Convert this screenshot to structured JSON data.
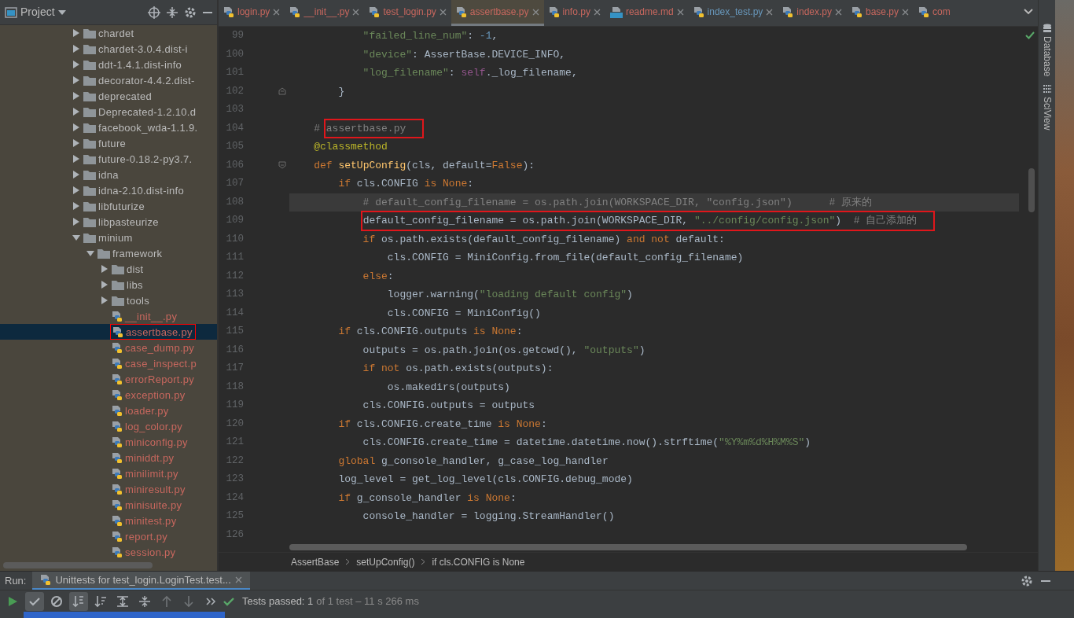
{
  "project_panel": {
    "title": "Project",
    "tree": [
      {
        "kind": "folder",
        "label": "chardet",
        "expanded": false,
        "selected": false,
        "annotated": false
      },
      {
        "kind": "folder",
        "label": "chardet-3.0.4.dist-i",
        "expanded": false,
        "selected": false,
        "annotated": false
      },
      {
        "kind": "folder",
        "label": "ddt-1.4.1.dist-info",
        "expanded": false,
        "selected": false,
        "annotated": false
      },
      {
        "kind": "folder",
        "label": "decorator-4.4.2.dist-",
        "expanded": false,
        "selected": false,
        "annotated": false
      },
      {
        "kind": "folder",
        "label": "deprecated",
        "expanded": false,
        "selected": false,
        "annotated": false
      },
      {
        "kind": "folder",
        "label": "Deprecated-1.2.10.d",
        "expanded": false,
        "selected": false,
        "annotated": false
      },
      {
        "kind": "folder",
        "label": "facebook_wda-1.1.9.",
        "expanded": false,
        "selected": false,
        "annotated": false
      },
      {
        "kind": "folder",
        "label": "future",
        "expanded": false,
        "selected": false,
        "annotated": false
      },
      {
        "kind": "folder",
        "label": "future-0.18.2-py3.7.",
        "expanded": false,
        "selected": false,
        "annotated": false
      },
      {
        "kind": "folder",
        "label": "idna",
        "expanded": false,
        "selected": false,
        "annotated": false
      },
      {
        "kind": "folder",
        "label": "idna-2.10.dist-info",
        "expanded": false,
        "selected": false,
        "annotated": false
      },
      {
        "kind": "folder",
        "label": "libfuturize",
        "expanded": false,
        "selected": false,
        "annotated": false
      },
      {
        "kind": "folder",
        "label": "libpasteurize",
        "expanded": false,
        "selected": false,
        "annotated": false
      },
      {
        "kind": "folder",
        "label": "minium",
        "expanded": true,
        "selected": false,
        "annotated": false,
        "children": [
          {
            "kind": "folder",
            "label": "framework",
            "expanded": true,
            "selected": false,
            "annotated": false,
            "children": [
              {
                "kind": "folder",
                "label": "dist",
                "expanded": false,
                "selected": false,
                "annotated": false
              },
              {
                "kind": "folder",
                "label": "libs",
                "expanded": false,
                "selected": false,
                "annotated": false
              },
              {
                "kind": "folder",
                "label": "tools",
                "expanded": false,
                "selected": false,
                "annotated": false
              },
              {
                "kind": "file",
                "label": "__init__.py",
                "selected": false,
                "annotated": false
              },
              {
                "kind": "file",
                "label": "assertbase.py",
                "selected": true,
                "annotated": true
              },
              {
                "kind": "file",
                "label": "case_dump.py",
                "selected": false,
                "annotated": false
              },
              {
                "kind": "file",
                "label": "case_inspect.p",
                "selected": false,
                "annotated": false
              },
              {
                "kind": "file",
                "label": "errorReport.py",
                "selected": false,
                "annotated": false
              },
              {
                "kind": "file",
                "label": "exception.py",
                "selected": false,
                "annotated": false
              },
              {
                "kind": "file",
                "label": "loader.py",
                "selected": false,
                "annotated": false
              },
              {
                "kind": "file",
                "label": "log_color.py",
                "selected": false,
                "annotated": false
              },
              {
                "kind": "file",
                "label": "miniconfig.py",
                "selected": false,
                "annotated": false
              },
              {
                "kind": "file",
                "label": "miniddt.py",
                "selected": false,
                "annotated": false
              },
              {
                "kind": "file",
                "label": "minilimit.py",
                "selected": false,
                "annotated": false
              },
              {
                "kind": "file",
                "label": "miniresult.py",
                "selected": false,
                "annotated": false
              },
              {
                "kind": "file",
                "label": "minisuite.py",
                "selected": false,
                "annotated": false
              },
              {
                "kind": "file",
                "label": "minitest.py",
                "selected": false,
                "annotated": false
              },
              {
                "kind": "file",
                "label": "report.py",
                "selected": false,
                "annotated": false
              },
              {
                "kind": "file",
                "label": "session.py",
                "selected": false,
                "annotated": false
              }
            ]
          }
        ]
      }
    ]
  },
  "tabs": [
    {
      "kind": "py",
      "label": "login.py",
      "selected": false,
      "color": "#c7675e"
    },
    {
      "kind": "py",
      "label": "__init__.py",
      "selected": false,
      "color": "#c7675e"
    },
    {
      "kind": "py",
      "label": "test_login.py",
      "selected": false,
      "color": "#c7675e"
    },
    {
      "kind": "py",
      "label": "assertbase.py",
      "selected": true,
      "color": "#c7675e"
    },
    {
      "kind": "py",
      "label": "info.py",
      "selected": false,
      "color": "#c7675e"
    },
    {
      "kind": "md",
      "label": "readme.md",
      "selected": false,
      "color": "#c7675e"
    },
    {
      "kind": "py",
      "label": "index_test.py",
      "selected": false,
      "color": "#6897bb"
    },
    {
      "kind": "py",
      "label": "index.py",
      "selected": false,
      "color": "#c7675e"
    },
    {
      "kind": "py",
      "label": "base.py",
      "selected": false,
      "color": "#c7675e"
    },
    {
      "kind": "py",
      "label": "com",
      "selected": false,
      "color": "#c7675e"
    }
  ],
  "editor": {
    "lines": [
      {
        "number": "99",
        "current": false,
        "code": [
          {
            "kind": "s",
            "text": "            \"failed_line_num\""
          },
          {
            "kind": "p",
            "text": ": "
          },
          {
            "kind": "n",
            "text": "-1"
          },
          {
            "kind": "p",
            "text": ","
          }
        ]
      },
      {
        "number": "100",
        "current": false,
        "code": [
          {
            "kind": "s",
            "text": "            \"device\""
          },
          {
            "kind": "p",
            "text": ": AssertBase.DEVICE_INFO,"
          }
        ]
      },
      {
        "number": "101",
        "current": false,
        "code": [
          {
            "kind": "s",
            "text": "            \"log_filename\""
          },
          {
            "kind": "p",
            "text": ": "
          },
          {
            "kind": "self",
            "text": "self"
          },
          {
            "kind": "p",
            "text": "._log_filename,"
          }
        ]
      },
      {
        "number": "102",
        "current": false,
        "kind": "fold-end",
        "code": [
          {
            "kind": "p",
            "text": "        }"
          }
        ]
      },
      {
        "number": "103",
        "current": false
      },
      {
        "number": "104",
        "current": false,
        "code": [
          {
            "kind": "c",
            "text": "    # "
          },
          {
            "kind": "c",
            "text": "assertbase.py",
            "boxed": true
          }
        ]
      },
      {
        "number": "105",
        "current": false,
        "code": [
          {
            "kind": "d",
            "text": "    @classmethod"
          }
        ]
      },
      {
        "number": "106",
        "current": false,
        "kind": "fold-start",
        "code": [
          {
            "kind": "k",
            "text": "    def "
          },
          {
            "kind": "f",
            "text": "setUpConfig"
          },
          {
            "kind": "p",
            "text": "(cls, default="
          },
          {
            "kind": "k",
            "text": "False"
          },
          {
            "kind": "p",
            "text": "):"
          }
        ]
      },
      {
        "number": "107",
        "current": false,
        "code": [
          {
            "kind": "k",
            "text": "        if "
          },
          {
            "kind": "p",
            "text": "cls.CONFIG "
          },
          {
            "kind": "k",
            "text": "is None"
          },
          {
            "kind": "p",
            "text": ":"
          }
        ]
      },
      {
        "number": "108",
        "current": true,
        "code": [
          {
            "kind": "c",
            "text": "            # default_config_filename = os.path.join(WORKSPACE_DIR, \"config.json\")      # 原来的"
          }
        ]
      },
      {
        "number": "109",
        "current": false,
        "code": [
          {
            "kind": "p",
            "text": "            default_config_filename = os.path.join(WORKSPACE_DIR, ",
            "boxed": true
          },
          {
            "kind": "s",
            "text": "\"../config/config.json\"",
            "boxed": true
          },
          {
            "kind": "p",
            "text": ")  ",
            "boxed": true
          },
          {
            "kind": "c",
            "text": "# 自己添加的",
            "boxed": true
          }
        ]
      },
      {
        "number": "110",
        "current": false,
        "code": [
          {
            "kind": "k",
            "text": "            if "
          },
          {
            "kind": "p",
            "text": "os.path.exists(default_config_filename) "
          },
          {
            "kind": "k",
            "text": "and not "
          },
          {
            "kind": "p",
            "text": "default:"
          }
        ]
      },
      {
        "number": "111",
        "current": false,
        "code": [
          {
            "kind": "p",
            "text": "                cls.CONFIG = MiniConfig.from_file(default_config_filename)"
          }
        ]
      },
      {
        "number": "112",
        "current": false,
        "code": [
          {
            "kind": "k",
            "text": "            else"
          },
          {
            "kind": "p",
            "text": ":"
          }
        ]
      },
      {
        "number": "113",
        "current": false,
        "code": [
          {
            "kind": "p",
            "text": "                logger.warning("
          },
          {
            "kind": "s",
            "text": "\"loading default config\""
          },
          {
            "kind": "p",
            "text": ")"
          }
        ]
      },
      {
        "number": "114",
        "current": false,
        "code": [
          {
            "kind": "p",
            "text": "                cls.CONFIG = MiniConfig()"
          }
        ]
      },
      {
        "number": "115",
        "current": false,
        "code": [
          {
            "kind": "k",
            "text": "        if "
          },
          {
            "kind": "p",
            "text": "cls.CONFIG.outputs "
          },
          {
            "kind": "k",
            "text": "is None"
          },
          {
            "kind": "p",
            "text": ":"
          }
        ]
      },
      {
        "number": "116",
        "current": false,
        "code": [
          {
            "kind": "p",
            "text": "            outputs = os.path.join(os.getcwd(), "
          },
          {
            "kind": "s",
            "text": "\"outputs\""
          },
          {
            "kind": "p",
            "text": ")"
          }
        ]
      },
      {
        "number": "117",
        "current": false,
        "code": [
          {
            "kind": "k",
            "text": "            if not "
          },
          {
            "kind": "p",
            "text": "os.path.exists(outputs):"
          }
        ]
      },
      {
        "number": "118",
        "current": false,
        "code": [
          {
            "kind": "p",
            "text": "                os.makedirs(outputs)"
          }
        ]
      },
      {
        "number": "119",
        "current": false,
        "code": [
          {
            "kind": "p",
            "text": "            cls.CONFIG.outputs = outputs"
          }
        ]
      },
      {
        "number": "120",
        "current": false,
        "code": [
          {
            "kind": "k",
            "text": "        if "
          },
          {
            "kind": "p",
            "text": "cls.CONFIG.create_time "
          },
          {
            "kind": "k",
            "text": "is None"
          },
          {
            "kind": "p",
            "text": ":"
          }
        ]
      },
      {
        "number": "121",
        "current": false,
        "code": [
          {
            "kind": "p",
            "text": "            cls.CONFIG.create_time = datetime.datetime.now().strftime("
          },
          {
            "kind": "s",
            "text": "\"%Y%m%d%H%M%S\""
          },
          {
            "kind": "p",
            "text": ")"
          }
        ]
      },
      {
        "number": "122",
        "current": false,
        "code": [
          {
            "kind": "k",
            "text": "        global "
          },
          {
            "kind": "p",
            "text": "g_console_handler, g_case_log_handler"
          }
        ]
      },
      {
        "number": "123",
        "current": false,
        "code": [
          {
            "kind": "p",
            "text": "        log_level = get_log_level(cls.CONFIG.debug_mode)"
          }
        ]
      },
      {
        "number": "124",
        "current": false,
        "code": [
          {
            "kind": "k",
            "text": "        if "
          },
          {
            "kind": "p",
            "text": "g_console_handler "
          },
          {
            "kind": "k",
            "text": "is None"
          },
          {
            "kind": "p",
            "text": ":"
          }
        ]
      },
      {
        "number": "125",
        "current": false,
        "code": [
          {
            "kind": "p",
            "text": "            console_handler = logging.StreamHandler()"
          }
        ]
      },
      {
        "number": "126",
        "current": false
      }
    ],
    "breadcrumbs": [
      "AssertBase",
      "setUpConfig()",
      "if cls.CONFIG is None"
    ]
  },
  "side_tools": [
    {
      "kind": "database",
      "label": "Database"
    },
    {
      "kind": "sciview",
      "label": "SciView"
    }
  ],
  "run_panel": {
    "label": "Run:",
    "tab": "Unittests for test_login.LoginTest.test...",
    "tools": [
      {
        "kind": "play",
        "on": false,
        "disabled": false
      },
      {
        "kind": "check",
        "on": true,
        "disabled": false
      },
      {
        "kind": "stop",
        "on": false,
        "disabled": false
      },
      {
        "kind": "sort-alpha",
        "on": true,
        "disabled": false
      },
      {
        "kind": "sort-duration",
        "on": false,
        "disabled": false
      },
      {
        "kind": "expand",
        "on": false,
        "disabled": false
      },
      {
        "kind": "collapse",
        "on": false,
        "disabled": false
      },
      {
        "kind": "up",
        "on": false,
        "disabled": true
      },
      {
        "kind": "down",
        "on": false,
        "disabled": true
      },
      {
        "kind": "more",
        "on": false,
        "disabled": false
      }
    ],
    "status": "Tests passed: 1",
    "status_detail": "of 1 test – 11 s 266 ms"
  }
}
